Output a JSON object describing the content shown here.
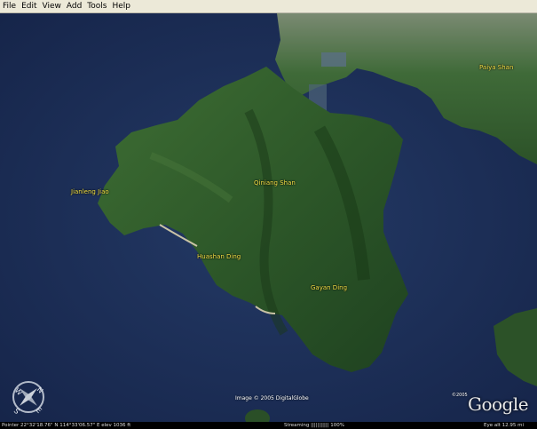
{
  "menu": [
    "File",
    "Edit",
    "View",
    "Add",
    "Tools",
    "Help"
  ],
  "labels": {
    "jianleng_jiao": "Jianleng Jiao",
    "qiniang_shan": "Qiniang Shan",
    "huashan_ding": "Huashan Ding",
    "gayan_ding": "Gayan Ding",
    "paiya_shan": "Paiya Shan"
  },
  "compass": {
    "west": "W",
    "east": "E",
    "north": "N",
    "south": "S"
  },
  "overlay": {
    "image_credit": "Image © 2005 DigitalGlobe",
    "google_copyright": "©2005",
    "google_logo": "Google"
  },
  "status": {
    "pointer": "Pointer  22°32'18.76\" N    114°33'06.57\" E     elev  1036 ft",
    "streaming": "Streaming ||||||||||| 100%",
    "eye_alt": "Eye  alt    12.95 mi"
  },
  "colors": {
    "ocean": "#1b2d55",
    "land": "#2f5a2a",
    "label": "#f5e44a"
  }
}
